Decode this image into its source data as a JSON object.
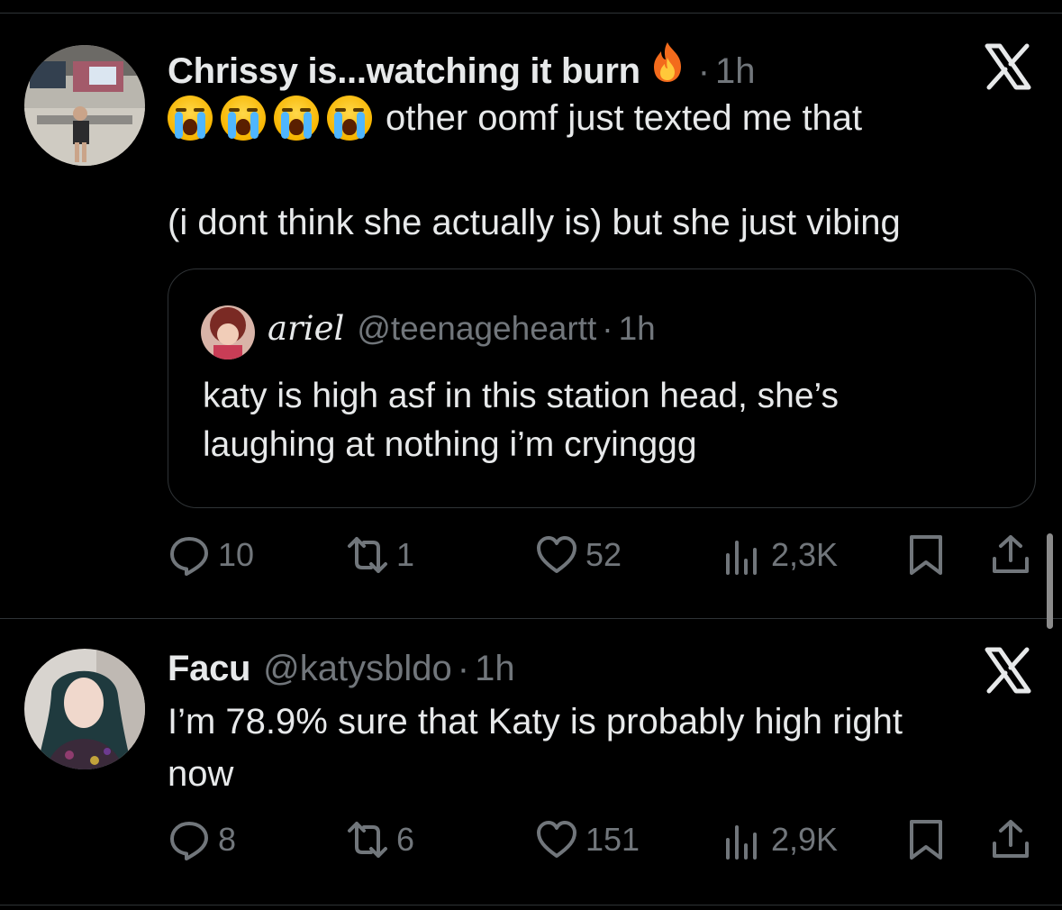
{
  "tweets": [
    {
      "display_name": "Chrissy is...watching it burn",
      "name_emoji": "fire-emoji",
      "separator": "·",
      "time": "1h",
      "crying_emojis": [
        "loudly-crying-face",
        "loudly-crying-face",
        "loudly-crying-face",
        "loudly-crying-face"
      ],
      "text_line1": "other oomf just texted me that",
      "text_line2": "(i dont think she actually is) but she just vibing",
      "quote": {
        "display_name": "ariel",
        "handle": "@teenageheartt",
        "separator": "·",
        "time": "1h",
        "text_line1": "katy is high asf in this station head, she’s",
        "text_line2": "laughing at nothing i’m cryinggg"
      },
      "stats": {
        "replies": "10",
        "reposts": "1",
        "likes": "52",
        "views": "2,3K"
      }
    },
    {
      "display_name": "Facu",
      "handle": "@katysbldo",
      "separator": "·",
      "time": "1h",
      "text_line1": "I’m 78.9% sure that Katy is probably high right",
      "text_line2": "now",
      "stats": {
        "replies": "8",
        "reposts": "6",
        "likes": "151",
        "views": "2,9K"
      }
    }
  ],
  "colors": {
    "background": "#000000",
    "text": "#e7e9ea",
    "muted": "#71767b",
    "border": "#2f3336"
  },
  "icons": [
    "reply-icon",
    "repost-icon",
    "like-icon",
    "views-icon",
    "bookmark-icon",
    "share-icon",
    "x-logo-icon"
  ]
}
